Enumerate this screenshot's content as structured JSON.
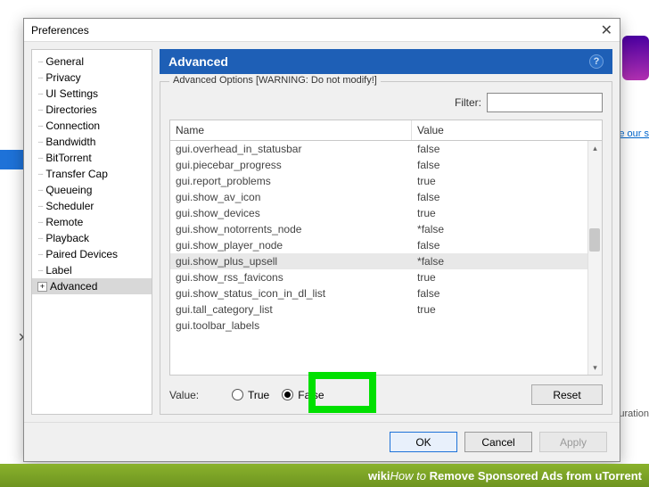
{
  "window": {
    "title": "Preferences",
    "close_glyph": "✕"
  },
  "bg": {
    "link": "e our s",
    "text": "uration",
    "x": "✕"
  },
  "tree": {
    "items": [
      {
        "label": "General"
      },
      {
        "label": "Privacy"
      },
      {
        "label": "UI Settings"
      },
      {
        "label": "Directories"
      },
      {
        "label": "Connection"
      },
      {
        "label": "Bandwidth"
      },
      {
        "label": "BitTorrent"
      },
      {
        "label": "Transfer Cap"
      },
      {
        "label": "Queueing"
      },
      {
        "label": "Scheduler"
      },
      {
        "label": "Remote"
      },
      {
        "label": "Playback"
      },
      {
        "label": "Paired Devices"
      },
      {
        "label": "Label"
      },
      {
        "label": "Advanced",
        "selected": true,
        "expandable": true
      }
    ]
  },
  "panel": {
    "header": "Advanced",
    "group_title": "Advanced Options [WARNING: Do not modify!]",
    "filter_label": "Filter:",
    "filter_value": "",
    "columns": {
      "name": "Name",
      "value": "Value"
    },
    "rows": [
      {
        "name": "gui.overhead_in_statusbar",
        "value": "false"
      },
      {
        "name": "gui.piecebar_progress",
        "value": "false"
      },
      {
        "name": "gui.report_problems",
        "value": "true"
      },
      {
        "name": "gui.show_av_icon",
        "value": "false"
      },
      {
        "name": "gui.show_devices",
        "value": "true"
      },
      {
        "name": "gui.show_notorrents_node",
        "value": "*false"
      },
      {
        "name": "gui.show_player_node",
        "value": "false"
      },
      {
        "name": "gui.show_plus_upsell",
        "value": "*false",
        "selected": true
      },
      {
        "name": "gui.show_rss_favicons",
        "value": "true"
      },
      {
        "name": "gui.show_status_icon_in_dl_list",
        "value": "false"
      },
      {
        "name": "gui.tall_category_list",
        "value": "true"
      },
      {
        "name": "gui.toolbar_labels",
        "value": ""
      }
    ],
    "value_label": "Value:",
    "true_label": "True",
    "false_label": "False",
    "selected_radio": "false",
    "reset_label": "Reset"
  },
  "buttons": {
    "ok": "OK",
    "cancel": "Cancel",
    "apply": "Apply"
  },
  "wikibar": {
    "prefix": "wiki",
    "mid": "How to ",
    "title": "Remove Sponsored Ads from uTorrent"
  }
}
